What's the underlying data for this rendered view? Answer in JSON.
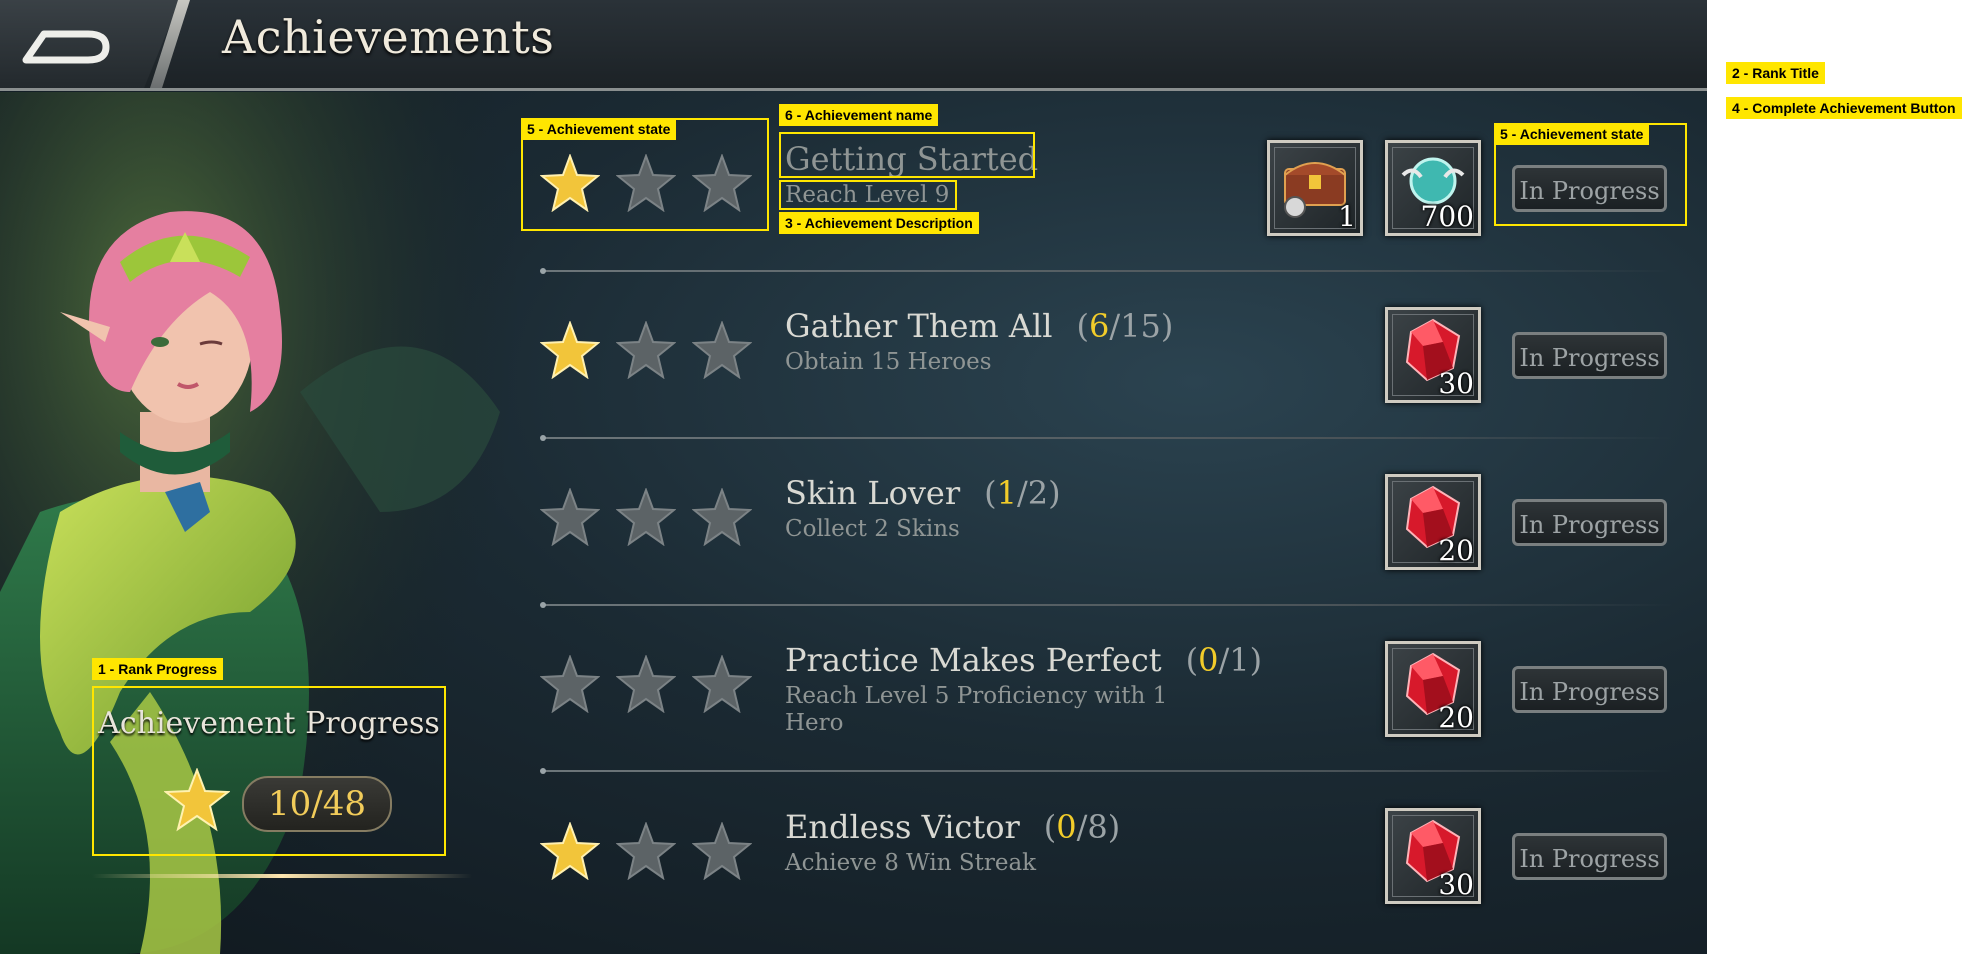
{
  "header": {
    "title": "Achievements",
    "back_icon": "back-arrow-icon"
  },
  "rank": {
    "title": "Achievement Progress",
    "progress": "10/48",
    "current": 10,
    "total": 48
  },
  "achievements": [
    {
      "name": "Getting Started",
      "count_current": "",
      "count_total": "",
      "description": "Reach Level 9",
      "stars_earned": 1,
      "rewards": [
        {
          "icon": "chest-icon",
          "qty": "1"
        },
        {
          "icon": "exp-icon",
          "qty": "700"
        }
      ],
      "button": "In Progress"
    },
    {
      "name": "Gather Them All",
      "count_current": "6",
      "count_total": "/15)",
      "description": "Obtain 15 Heroes",
      "stars_earned": 1,
      "rewards": [
        {
          "icon": "ruby-icon",
          "qty": "30"
        }
      ],
      "button": "In Progress"
    },
    {
      "name": "Skin Lover",
      "count_current": "1",
      "count_total": "/2)",
      "description": "Collect 2 Skins",
      "stars_earned": 0,
      "rewards": [
        {
          "icon": "ruby-icon",
          "qty": "20"
        }
      ],
      "button": "In Progress"
    },
    {
      "name": "Practice Makes Perfect",
      "count_current": "0",
      "count_total": "/1)",
      "description": "Reach Level 5 Proficiency with 1 Hero",
      "stars_earned": 0,
      "rewards": [
        {
          "icon": "ruby-icon",
          "qty": "20"
        }
      ],
      "button": "In Progress"
    },
    {
      "name": "Endless Victor",
      "count_current": "0",
      "count_total": "/8)",
      "description": "Achieve 8 Win Streak",
      "stars_earned": 1,
      "rewards": [
        {
          "icon": "ruby-icon",
          "qty": "30"
        }
      ],
      "button": "In Progress"
    }
  ],
  "count_open": "(",
  "annotations": {
    "rank_progress": "1 - Rank Progress",
    "rank_title": "2 - Rank Title",
    "achievement_description": "3 - Achievement Description",
    "complete_button": "4 - Complete Achievement Button",
    "achievement_state_left": "5 - Achievement state",
    "achievement_state_right": "5 - Achievement state",
    "achievement_name": "6 - Achievement name"
  },
  "colors": {
    "annotation": "#ffe600",
    "star_gold": "#f2c53a",
    "count_highlight": "#f2cc2a",
    "background": "#1b2a33"
  }
}
